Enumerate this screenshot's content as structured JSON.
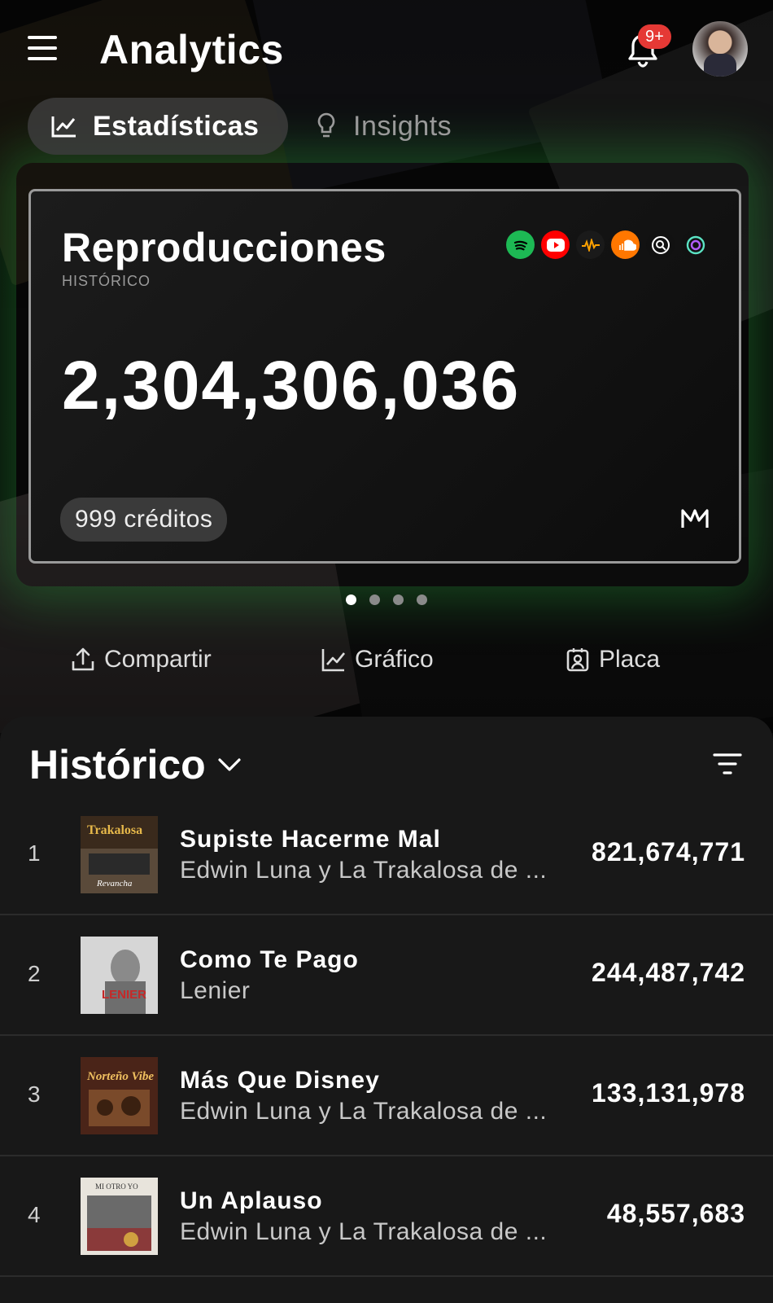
{
  "header": {
    "title": "Analytics",
    "notifications_badge": "9+"
  },
  "tabs": [
    {
      "label": "Estadísticas",
      "icon": "line-chart-icon",
      "active": true
    },
    {
      "label": "Insights",
      "icon": "lightbulb-icon",
      "active": false
    }
  ],
  "card": {
    "title": "Reproducciones",
    "subtitle": "HISTÓRICO",
    "total": "2,304,306,036",
    "credits": "999 créditos",
    "platforms": [
      {
        "name": "spotify-icon",
        "color": "#1DB954"
      },
      {
        "name": "youtube-icon",
        "color": "#FF0000"
      },
      {
        "name": "audiomack-icon",
        "color": "#1a1a1a"
      },
      {
        "name": "soundcloud-icon",
        "color": "#FF7700"
      },
      {
        "name": "search-platform-icon",
        "color": "#111111"
      },
      {
        "name": "circle-platform-icon",
        "color": "#111111"
      }
    ]
  },
  "carousel": {
    "pages": 4,
    "active_index": 0
  },
  "actions": [
    {
      "label": "Compartir",
      "icon": "share-icon"
    },
    {
      "label": "Gráfico",
      "icon": "chart-icon"
    },
    {
      "label": "Placa",
      "icon": "plaque-icon"
    }
  ],
  "list": {
    "title": "Histórico",
    "rows": [
      {
        "rank": "1",
        "song": "Supiste Hacerme Mal",
        "artist": "Edwin Luna y La Trakalosa de ...",
        "plays": "821,674,771"
      },
      {
        "rank": "2",
        "song": "Como Te Pago",
        "artist": "Lenier",
        "plays": "244,487,742"
      },
      {
        "rank": "3",
        "song": "Más Que Disney",
        "artist": "Edwin Luna y La Trakalosa de ...",
        "plays": "133,131,978"
      },
      {
        "rank": "4",
        "song": "Un Aplauso",
        "artist": "Edwin Luna y La Trakalosa de ...",
        "plays": "48,557,683"
      }
    ]
  }
}
